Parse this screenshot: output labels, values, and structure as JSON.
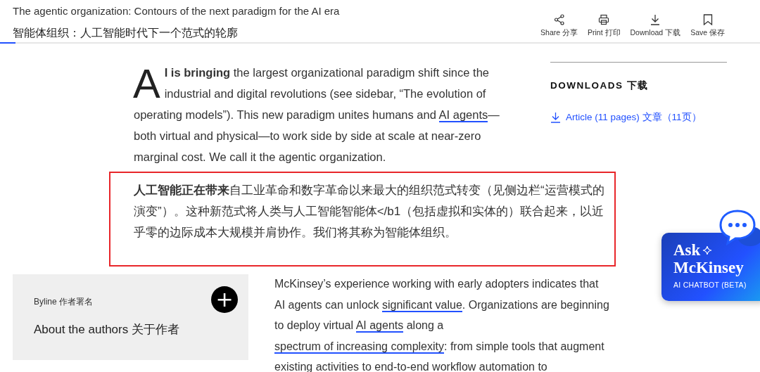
{
  "header": {
    "title": "The agentic organization: Contours of the next paradigm for the AI era",
    "subtitle": "智能体组织：人工智能时代下一个范式的轮廓",
    "reading_progress": {
      "level": 0.02
    },
    "tools": [
      {
        "kind": "share",
        "label": "Share 分享"
      },
      {
        "kind": "print",
        "label": "Print 打印"
      },
      {
        "kind": "download",
        "label": "Download 下载"
      },
      {
        "kind": "save",
        "label": "Save 保存"
      }
    ]
  },
  "intro": {
    "drop_cap": "A",
    "segments": [
      {
        "kind": "text",
        "text": "**I is bringing** the largest organizational paradigm shift since the industrial and digital revolutions (see sidebar, “The evolution of operating models”). This new paradigm unites humans and "
      },
      {
        "kind": "link",
        "text": "AI agents"
      },
      {
        "kind": "text",
        "text": "—both virtual and physical—to work side by side at scale at near-zero marginal cost. We call it the agentic organization."
      }
    ]
  },
  "sidebar": {
    "heading": "DOWNLOADS 下载",
    "links": [
      {
        "label": "Article (11 pages) 文章（11页）"
      }
    ]
  },
  "translation": {
    "text": "**人工智能正在带来**自工业革命和数字革命以来最大的组织范式转变（见侧边栏“运营模式的演变”）。这种新范式将人类与人工智能智能体</b1（包括虚拟和实体的）联合起来，以近乎零的边际成本大规模并肩协作。我们将其称为智能体组织。"
  },
  "byline": {
    "label": "Byline 作者署名",
    "title": "About the authors 关于作者",
    "expand_symbol": "+"
  },
  "body": {
    "segments": [
      {
        "kind": "text",
        "text": "McKinsey’s experience working with early adopters indicates that AI agents can unlock "
      },
      {
        "kind": "link",
        "text": "significant value"
      },
      {
        "kind": "text",
        "text": ". Organizations are beginning to deploy virtual "
      },
      {
        "kind": "link",
        "text": "AI agents"
      },
      {
        "kind": "text",
        "text": " along a "
      },
      {
        "kind": "link",
        "text": "spectrum of increasing complexity"
      },
      {
        "kind": "text",
        "text": ": from simple tools that augment existing activities to end-to-end workflow automation to"
      }
    ]
  },
  "chatbot": {
    "line1": "Ask",
    "line2": "McKinsey",
    "caption": "AI CHATBOT (BETA)"
  }
}
